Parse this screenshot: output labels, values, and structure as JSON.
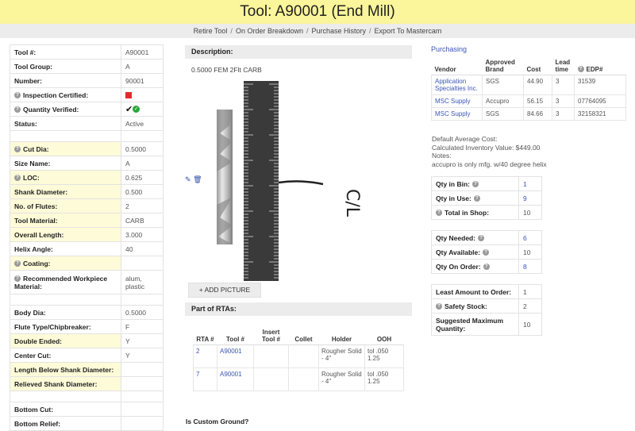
{
  "header": {
    "title": "Tool: A90001 (End Mill)"
  },
  "nav": {
    "items": [
      "Retire Tool",
      "On Order Breakdown",
      "Purchase History",
      "Export To Mastercam"
    ],
    "separator": "/"
  },
  "properties": [
    {
      "label": "Tool #:",
      "value": "A90001"
    },
    {
      "label": "Tool Group:",
      "value": "A"
    },
    {
      "label": "Number:",
      "value": "90001"
    },
    {
      "label": "Inspection Certified:",
      "value": "",
      "help": true,
      "indicator": "red-square"
    },
    {
      "label": "Quantity Verified:",
      "value": "",
      "help": true,
      "indicator": "checks"
    },
    {
      "label": "Status:",
      "value": "Active"
    },
    {
      "gap": true
    },
    {
      "label": "Cut Dia:",
      "value": "0.5000",
      "help": true,
      "highlight": true
    },
    {
      "label": "Size Name:",
      "value": "A"
    },
    {
      "label": "LOC:",
      "value": "0.625",
      "help": true,
      "highlight": true
    },
    {
      "label": "Shank Diameter:",
      "value": "0.500",
      "highlight": true
    },
    {
      "label": "No. of Flutes:",
      "value": "2",
      "highlight": true
    },
    {
      "label": "Tool Material:",
      "value": "CARB",
      "highlight": true
    },
    {
      "label": "Overall Length:",
      "value": "3.000",
      "highlight": true
    },
    {
      "label": "Helix Angle:",
      "value": "40"
    },
    {
      "label": "Coating:",
      "value": "",
      "help": true,
      "highlight": true
    },
    {
      "label": "Recommended Workpiece Material:",
      "value": "alum, plastic",
      "help": true,
      "tall": true
    },
    {
      "gap": true
    },
    {
      "label": "Body Dia:",
      "value": "0.5000"
    },
    {
      "label": "Flute Type/Chipbreaker:",
      "value": "F"
    },
    {
      "label": "Double Ended:",
      "value": "Y",
      "highlight": true
    },
    {
      "label": "Center Cut:",
      "value": "Y"
    },
    {
      "label": "Length Below Shank Diameter:",
      "value": "",
      "highlight": true
    },
    {
      "label": "Relieved Shank Diameter:",
      "value": "",
      "highlight": true
    },
    {
      "gap": true
    },
    {
      "label": "Bottom Cut:",
      "value": ""
    },
    {
      "label": "Bottom Relief:",
      "value": ""
    }
  ],
  "description": {
    "heading": "Description:",
    "text": "0.5000 FEM 2Flt CARB",
    "add_picture_label": "+ ADD PICTURE",
    "edit_icon": "pencil-icon",
    "delete_icon": "trash-icon",
    "photo_annotation": "C/L"
  },
  "rtas": {
    "heading": "Part of RTAs:",
    "columns": [
      "RTA #",
      "Tool #",
      "Insert Tool #",
      "Collet",
      "Holder",
      "OOH"
    ],
    "rows": [
      [
        "2",
        "A90001",
        "",
        "",
        "Rougher Solid - 4\"",
        "tol .050 1.25"
      ],
      [
        "7",
        "A90001",
        "",
        "",
        "Rougher Solid - 4\"",
        "tol .050 1.25"
      ]
    ]
  },
  "custom_ground_label": "Is Custom Ground?",
  "purchasing": {
    "title": "Purchasing",
    "columns": [
      "Vendor",
      "Approved Brand",
      "Cost",
      "Lead time",
      "EDP#"
    ],
    "rows": [
      [
        "Application Specialties Inc.",
        "SGS",
        "44.90",
        "3",
        "31539"
      ],
      [
        "MSC Supply",
        "Accupro",
        "56.15",
        "3",
        "07764095"
      ],
      [
        "MSC Supply",
        "SGS",
        "84.66",
        "3",
        "32158321"
      ]
    ],
    "notes": [
      "Default Average Cost:",
      "Calculated Inventory Value: $449.00",
      "Notes:",
      "accupro is only mfg. w/40 degree helix"
    ]
  },
  "quantities_1": [
    {
      "label": "Qty in Bin:",
      "value": "1",
      "help_after": true,
      "link": true
    },
    {
      "label": "Qty in Use:",
      "value": "9",
      "help_after": true,
      "link": true
    },
    {
      "label": "Total in Shop:",
      "value": "10",
      "help_before": true
    }
  ],
  "quantities_2": [
    {
      "label": "Qty Needed:",
      "value": "6",
      "help_after": true,
      "link": true
    },
    {
      "label": "Qty Available:",
      "value": "10",
      "help_after": true
    },
    {
      "label": "Qty On Order:",
      "value": "8",
      "help_after": true,
      "link": true
    }
  ],
  "quantities_3": [
    {
      "label": "Least Amount to Order:",
      "value": "1"
    },
    {
      "label": "Safety Stock:",
      "value": "2",
      "help_before": true
    },
    {
      "label": "Suggested Maximum Quantity:",
      "value": "10",
      "tall": true
    }
  ],
  "colors": {
    "title_bar": "#fbf59b",
    "link": "#3b55b8",
    "highlight": "#fdfbd8",
    "flag_red": "#e02b2b",
    "check_green": "#2aa63a"
  }
}
